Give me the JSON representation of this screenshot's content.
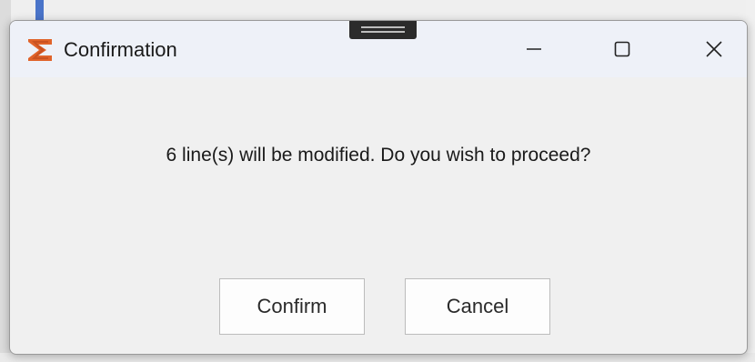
{
  "dialog": {
    "title": "Confirmation",
    "app_icon": "sigma-logo-icon",
    "message": "6 line(s) will be modified. Do you wish to proceed?",
    "confirm_label": "Confirm",
    "cancel_label": "Cancel"
  },
  "window_controls": {
    "minimize_icon": "minimize-icon",
    "maximize_icon": "maximize-icon",
    "close_icon": "close-icon"
  },
  "colors": {
    "logo_accent": "#e0632a",
    "titlebar": "#eef1f8",
    "body": "#f0f0f0"
  }
}
